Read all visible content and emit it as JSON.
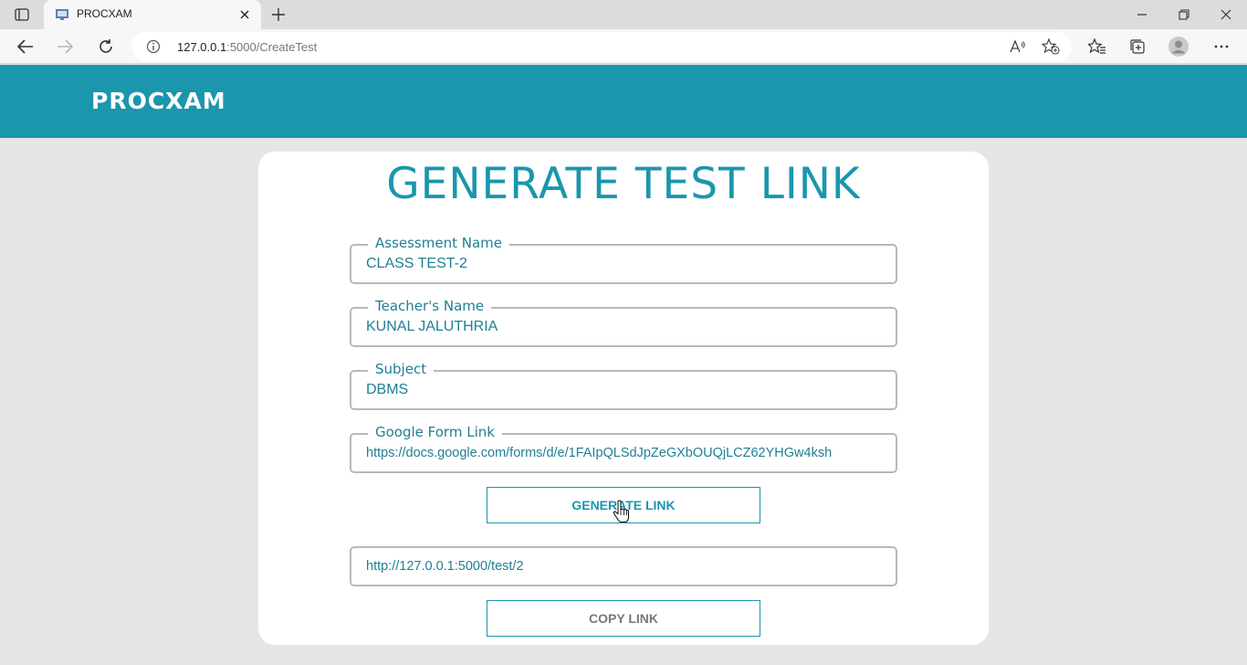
{
  "browser": {
    "tab_title": "PROCXAM",
    "url_host": "127.0.0.1",
    "url_path": ":5000/CreateTest",
    "icons": [
      "tab-actions-icon",
      "favicon-icon",
      "close-icon",
      "plus-icon",
      "minimize-icon",
      "restore-icon",
      "close-window-icon",
      "back-icon",
      "forward-icon",
      "refresh-icon",
      "info-icon",
      "read-aloud-icon",
      "add-favorite-icon",
      "favorites-icon",
      "collections-icon",
      "profile-icon",
      "more-icon"
    ]
  },
  "header": {
    "brand": "PROCXAM",
    "background_color": "#1a96ad"
  },
  "form": {
    "title": "GENERATE TEST LINK",
    "fields": [
      {
        "label": "Assessment Name",
        "value": "CLASS TEST-2"
      },
      {
        "label": "Teacher's Name",
        "value": "KUNAL JALUTHRIA"
      },
      {
        "label": "Subject",
        "value": "DBMS"
      },
      {
        "label": "Google Form Link",
        "value": "https://docs.google.com/forms/d/e/1FAIpQLSdJpZeGXbOUQjLCZ62YHGw4ksh"
      }
    ],
    "generate_label": "GENERATE LINK",
    "generated_link": "http://127.0.0.1:5000/test/2",
    "copy_label": "COPY LINK",
    "accent_color": "#1a96ad"
  }
}
